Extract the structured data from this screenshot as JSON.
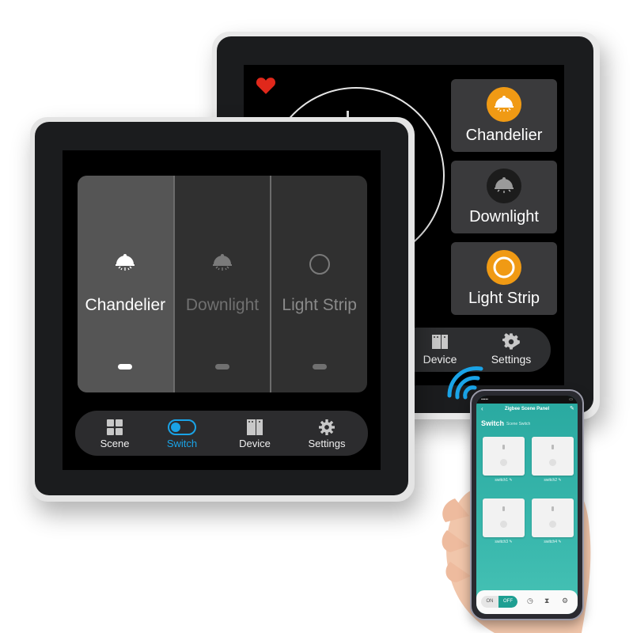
{
  "back_panel": {
    "heart_color": "#e0281b",
    "scene_cards": [
      {
        "label": "Chandelier",
        "icon": "chandelier-icon",
        "state": "on",
        "icon_bg": "#f09a14"
      },
      {
        "label": "Downlight",
        "icon": "downlight-icon",
        "state": "off",
        "icon_bg": "#1c1c1c"
      },
      {
        "label": "Light Strip",
        "icon": "light-strip-icon",
        "state": "on",
        "icon_bg": "#f09a14"
      }
    ],
    "nav": [
      {
        "label": "Device",
        "icon": "device-icon"
      },
      {
        "label": "Settings",
        "icon": "gear-icon"
      }
    ]
  },
  "front_panel": {
    "switches": [
      {
        "label": "Chandelier",
        "icon": "chandelier-icon",
        "state": "on"
      },
      {
        "label": "Downlight",
        "icon": "downlight-icon",
        "state": "off"
      },
      {
        "label": "Light Strip",
        "icon": "light-strip-icon",
        "state": "off"
      }
    ],
    "nav": [
      {
        "label": "Scene",
        "icon": "scene-grid-icon",
        "active": false
      },
      {
        "label": "Switch",
        "icon": "toggle-icon",
        "active": true
      },
      {
        "label": "Device",
        "icon": "device-icon",
        "active": false
      },
      {
        "label": "Settings",
        "icon": "gear-icon",
        "active": false
      }
    ],
    "accent_color": "#1aa3e6"
  },
  "phone": {
    "title": "Zigbee Scene Panel",
    "back_icon": "‹",
    "edit_icon": "✎",
    "tabs": [
      {
        "label": "Switch",
        "active": true
      },
      {
        "label": "Scene Switch",
        "active": false
      }
    ],
    "switches": [
      {
        "label": "switch1 ✎"
      },
      {
        "label": "switch2 ✎"
      },
      {
        "label": "switch3 ✎"
      },
      {
        "label": "switch4 ✎"
      }
    ],
    "bottom_bar": {
      "on_label": "ON",
      "off_label": "OFF",
      "icons": [
        "clock-icon",
        "hourglass-icon",
        "gear-icon"
      ]
    },
    "theme_color": "#2fb0a5"
  }
}
